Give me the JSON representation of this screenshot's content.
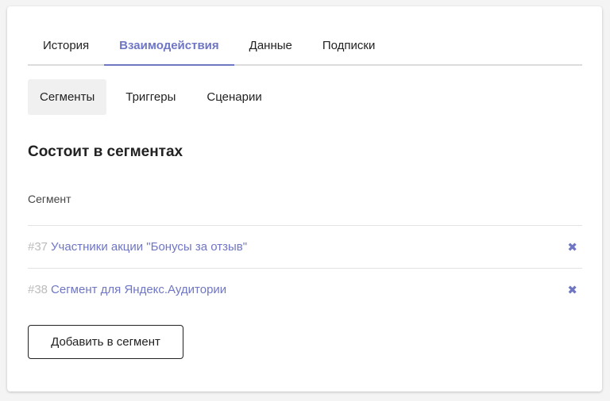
{
  "tabs": [
    {
      "label": "История"
    },
    {
      "label": "Взаимодействия"
    },
    {
      "label": "Данные"
    },
    {
      "label": "Подписки"
    }
  ],
  "active_tab": "Взаимодействия",
  "subtabs": [
    {
      "label": "Сегменты"
    },
    {
      "label": "Триггеры"
    },
    {
      "label": "Сценарии"
    }
  ],
  "active_subtab": "Сегменты",
  "section": {
    "title": "Состоит в сегментах",
    "column_header": "Сегмент"
  },
  "segments": [
    {
      "id": "#37",
      "name": "Участники акции \"Бонусы за отзыв\"",
      "remove_icon": "✖"
    },
    {
      "id": "#38",
      "name": "Сегмент для Яндекс.Аудитории",
      "remove_icon": "✖"
    }
  ],
  "add_button_label": "Добавить в сегмент",
  "colors": {
    "accent": "#6f76c4",
    "muted_id": "#bbbbbb",
    "subtab_active_bg": "#f0f0f0"
  }
}
